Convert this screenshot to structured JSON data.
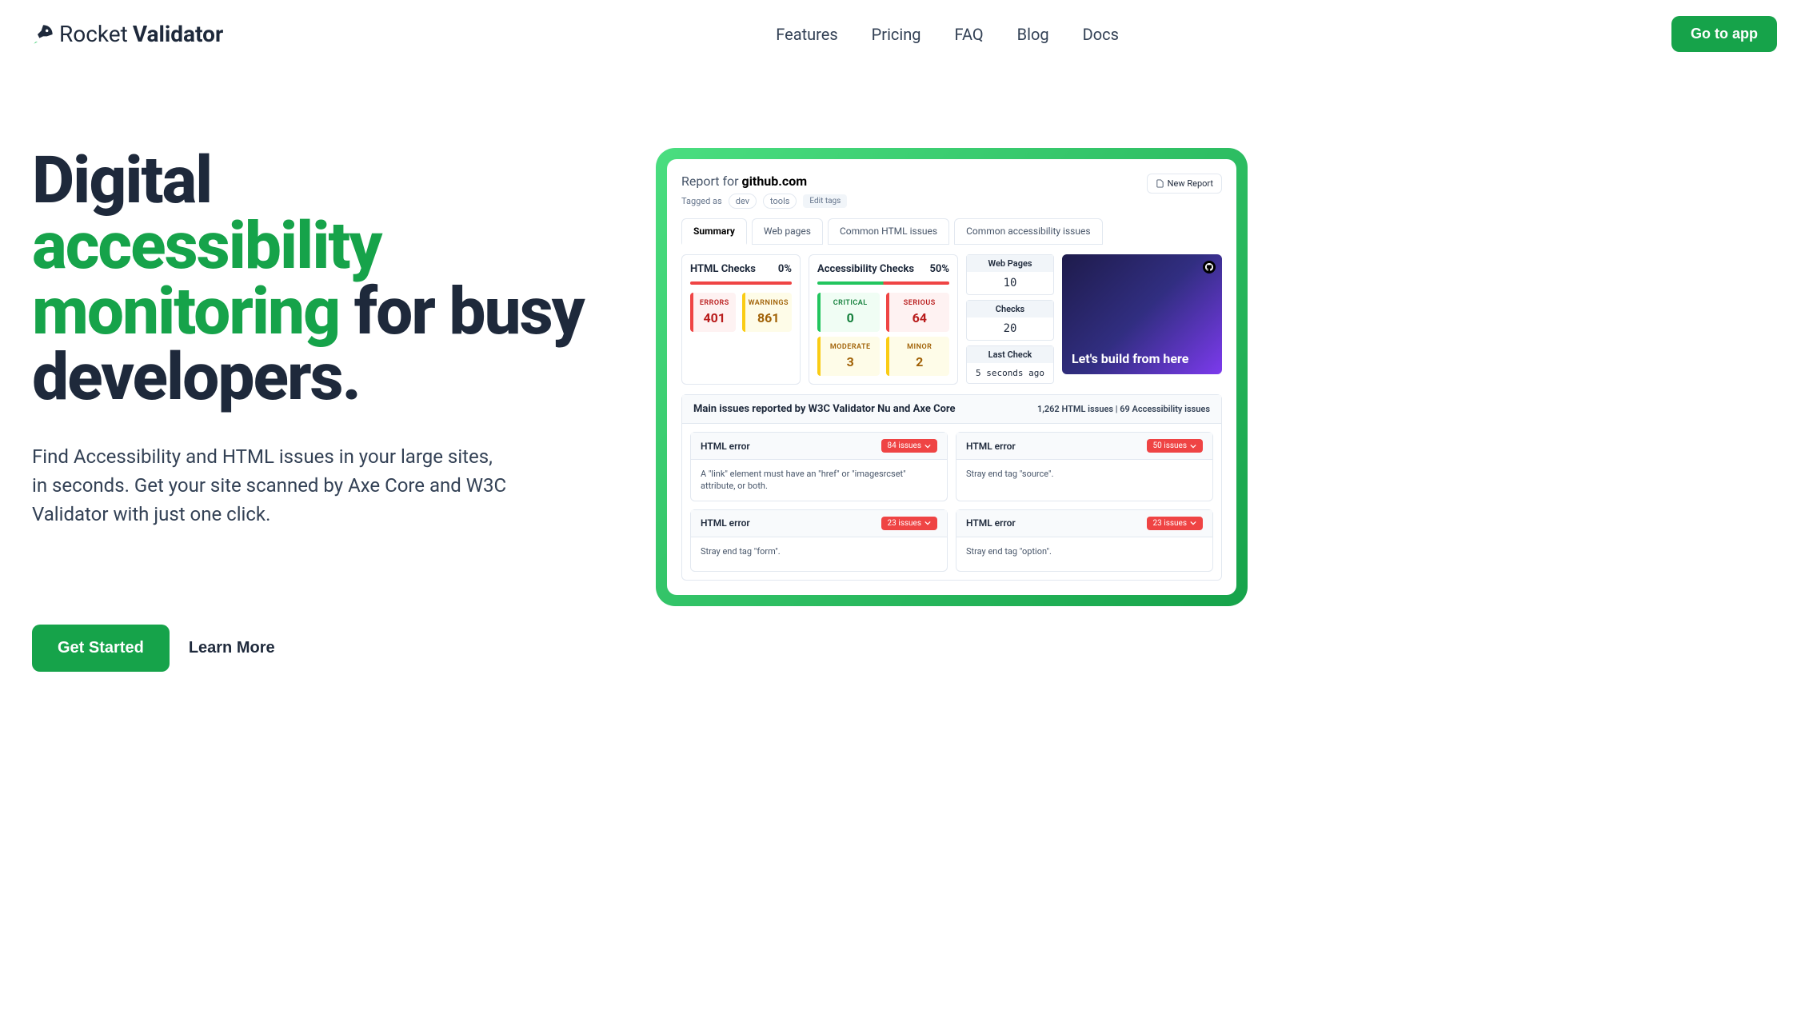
{
  "logo": {
    "text1": "Rocket",
    "text2": "Validator"
  },
  "nav": {
    "features": "Features",
    "pricing": "Pricing",
    "faq": "FAQ",
    "blog": "Blog",
    "docs": "Docs"
  },
  "cta_app": "Go to app",
  "hero": {
    "title_line1": "Digital",
    "title_green1": "accessibility",
    "title_green2": "monitoring",
    "title_rest": " for busy developers.",
    "subtitle": "Find Accessibility and HTML issues in your large sites, in seconds. Get your site scanned by Axe Core and W3C Validator with just one click.",
    "get_started": "Get Started",
    "learn_more": "Learn More"
  },
  "report": {
    "prefix": "Report for ",
    "domain": "github.com",
    "tagged_as": "Tagged as",
    "tags": {
      "dev": "dev",
      "tools": "tools"
    },
    "edit_tags": "Edit tags",
    "new_report": "New Report",
    "tabs": {
      "summary": "Summary",
      "web_pages": "Web pages",
      "html_issues": "Common HTML issues",
      "a11y_issues": "Common accessibility issues"
    },
    "html_checks": {
      "title": "HTML Checks",
      "pct": "0%",
      "errors_label": "ERRORS",
      "errors_value": "401",
      "warnings_label": "WARNINGS",
      "warnings_value": "861"
    },
    "a11y_checks": {
      "title": "Accessibility Checks",
      "pct": "50%",
      "critical_label": "CRITICAL",
      "critical_value": "0",
      "serious_label": "SERIOUS",
      "serious_value": "64",
      "moderate_label": "MODERATE",
      "moderate_value": "3",
      "minor_label": "MINOR",
      "minor_value": "2"
    },
    "side": {
      "web_pages_label": "Web Pages",
      "web_pages_value": "10",
      "checks_label": "Checks",
      "checks_value": "20",
      "last_check_label": "Last Check",
      "last_check_value": "5 seconds ago"
    },
    "preview_text": "Let's build from here",
    "issues_title": "Main issues reported by W3C Validator Nu and Axe Core",
    "issues_counts": "1,262 HTML issues   |   69 Accessibility issues",
    "issues": {
      "i1": {
        "type": "HTML error",
        "badge": "84 issues",
        "body": "A \"link\" element must have an \"href\" or \"imagesrcset\" attribute, or both."
      },
      "i2": {
        "type": "HTML error",
        "badge": "50 issues",
        "body": "Stray end tag \"source\"."
      },
      "i3": {
        "type": "HTML error",
        "badge": "23 issues",
        "body": "Stray end tag \"form\"."
      },
      "i4": {
        "type": "HTML error",
        "badge": "23 issues",
        "body": "Stray end tag \"option\"."
      }
    }
  }
}
